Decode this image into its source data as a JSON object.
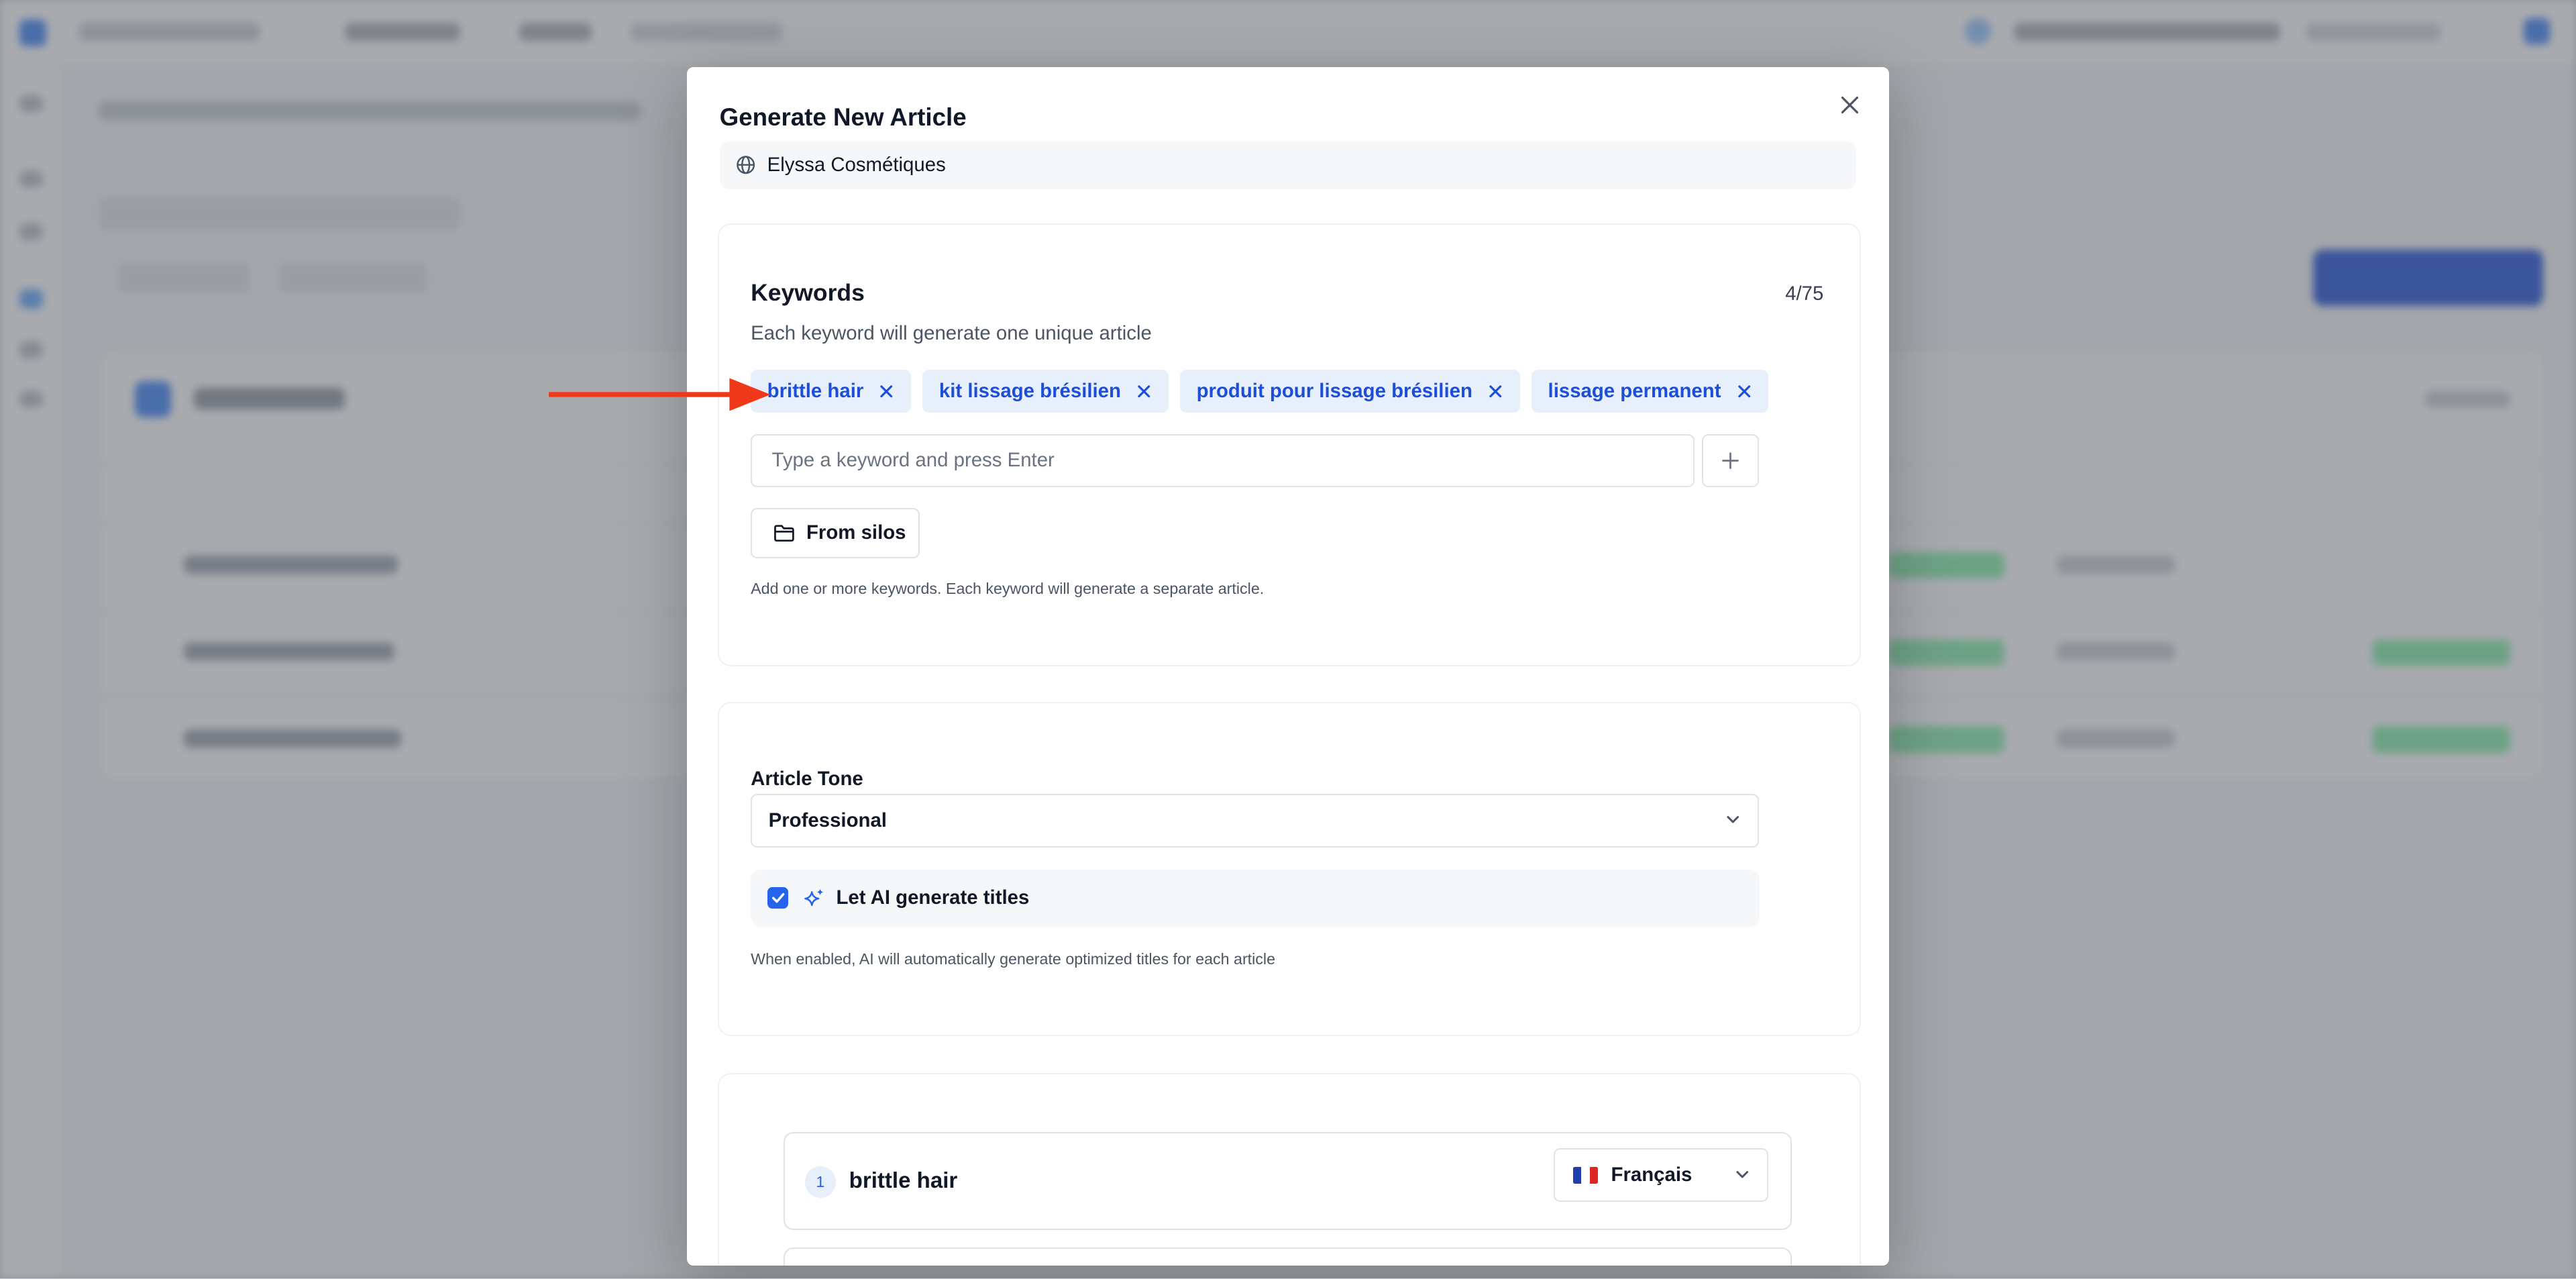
{
  "modal": {
    "title": "Generate New Article",
    "site_name": "Elyssa Cosmétiques",
    "keywords_section": {
      "title": "Keywords",
      "count": "4/75",
      "subtitle": "Each keyword will generate one unique article",
      "chips": [
        "brittle hair",
        "kit lissage brésilien",
        "produit pour lissage brésilien",
        "lissage permanent"
      ],
      "input_placeholder": "Type a keyword and press Enter",
      "from_silos_label": "From silos",
      "hint": "Add one or more keywords. Each keyword will generate a separate article."
    },
    "tone_section": {
      "label": "Article Tone",
      "value": "Professional",
      "ai_titles_label": "Let AI generate titles",
      "ai_titles_checked": true,
      "ai_hint": "When enabled, AI will automatically generate optimized titles for each article"
    },
    "keyword_list": [
      {
        "index": "1",
        "keyword": "brittle hair",
        "language": "Français",
        "flag": "france-flag"
      }
    ]
  },
  "colors": {
    "accent": "#2563eb",
    "chip_bg": "#e7effa",
    "annotation_arrow": "#f0391a"
  }
}
